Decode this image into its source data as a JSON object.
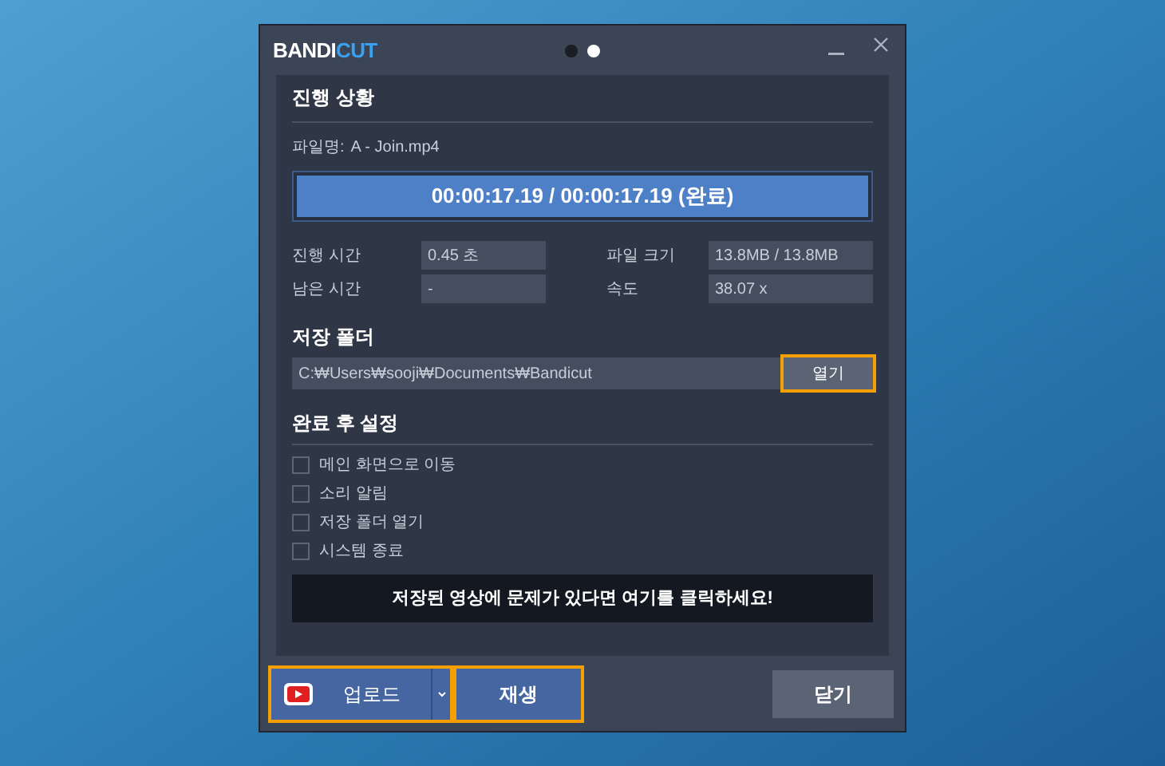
{
  "window": {
    "logo": {
      "part_1": "BANDI",
      "part_2": "CUT"
    },
    "page_dots": [
      {
        "selected": false
      },
      {
        "selected": true
      }
    ]
  },
  "progress": {
    "heading": "진행 상황",
    "file_label": "파일명:",
    "file_name": "A - Join.mp4",
    "bar_text": "00:00:17.19 / 00:00:17.19 (완료)",
    "level": 1,
    "stats": [
      {
        "label": "진행 시간",
        "value": "0.45 초"
      },
      {
        "label": "파일 크기",
        "value": "13.8MB / 13.8MB"
      },
      {
        "label": "남은 시간",
        "value": "-"
      },
      {
        "label": "속도",
        "value": "38.07 x"
      }
    ]
  },
  "save_folder": {
    "heading": "저장 폴더",
    "path": "C:₩Users₩sooji₩Documents₩Bandicut",
    "open_button": {
      "label": "열기",
      "highlighted": true
    }
  },
  "after_complete": {
    "heading": "완료 후 설정",
    "options": [
      {
        "label": "메인 화면으로 이동",
        "checked": false
      },
      {
        "label": "소리 알림",
        "checked": false
      },
      {
        "label": "저장 폴더 열기",
        "checked": false
      },
      {
        "label": "시스템 종료",
        "checked": false
      }
    ],
    "help_banner": "저장된 영상에 문제가 있다면 여기를 클릭하세요!"
  },
  "footer": {
    "upload_button": {
      "label": "업로드",
      "highlighted": true
    },
    "play_button": {
      "label": "재생",
      "highlighted": true
    },
    "close_button": {
      "label": "닫기",
      "highlighted": false
    }
  }
}
